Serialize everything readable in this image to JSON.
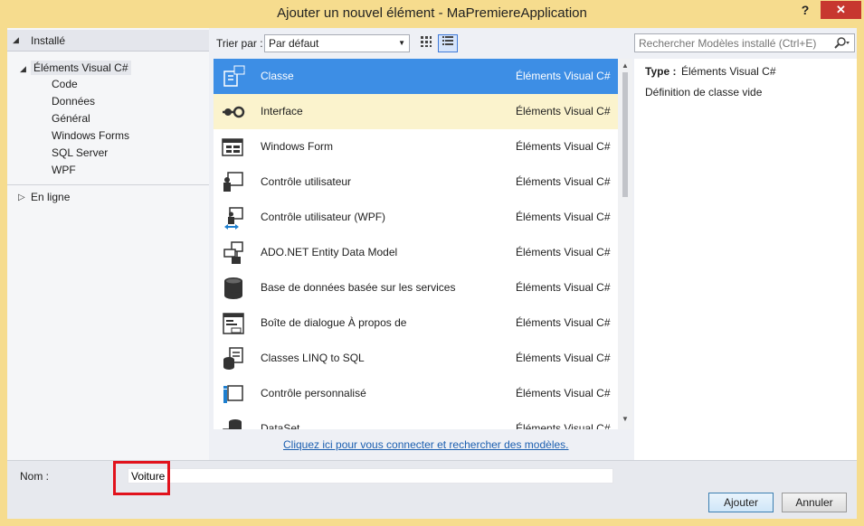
{
  "window": {
    "title": "Ajouter un nouvel élément - MaPremiereApplication",
    "help_label": "?",
    "close_label": "✕"
  },
  "tree": {
    "installed_label": "Installé",
    "root_label": "Éléments Visual C#",
    "children": [
      "Code",
      "Données",
      "Général",
      "Windows Forms",
      "SQL Server",
      "WPF"
    ],
    "online_label": "En ligne"
  },
  "toolbar": {
    "sort_label": "Trier par :",
    "sort_value": "Par défaut"
  },
  "items": [
    {
      "name": "Classe",
      "category": "Éléments Visual C#",
      "icon": "class-icon"
    },
    {
      "name": "Interface",
      "category": "Éléments Visual C#",
      "icon": "interface-icon"
    },
    {
      "name": "Windows Form",
      "category": "Éléments Visual C#",
      "icon": "windows-form-icon"
    },
    {
      "name": "Contrôle utilisateur",
      "category": "Éléments Visual C#",
      "icon": "user-control-icon"
    },
    {
      "name": "Contrôle utilisateur (WPF)",
      "category": "Éléments Visual C#",
      "icon": "wpf-user-control-icon"
    },
    {
      "name": "ADO.NET Entity Data Model",
      "category": "Éléments Visual C#",
      "icon": "entity-model-icon"
    },
    {
      "name": "Base de données basée sur les services",
      "category": "Éléments Visual C#",
      "icon": "database-icon"
    },
    {
      "name": "Boîte de dialogue À propos de",
      "category": "Éléments Visual C#",
      "icon": "about-box-icon"
    },
    {
      "name": "Classes LINQ to SQL",
      "category": "Éléments Visual C#",
      "icon": "linq-icon"
    },
    {
      "name": "Contrôle personnalisé",
      "category": "Éléments Visual C#",
      "icon": "custom-control-icon"
    },
    {
      "name": "DataSet",
      "category": "Éléments Visual C#",
      "icon": "dataset-icon"
    }
  ],
  "selected_index": 0,
  "hover_index": 1,
  "connect_link": "Cliquez ici pour vous connecter et rechercher des modèles.",
  "search": {
    "placeholder": "Rechercher Modèles installé (Ctrl+E)"
  },
  "details": {
    "type_label": "Type :",
    "type_value": "Éléments Visual C#",
    "description": "Définition de classe vide"
  },
  "form": {
    "name_label": "Nom :",
    "name_value": "Voiture",
    "ok_label": "Ajouter",
    "cancel_label": "Annuler"
  },
  "colors": {
    "title_bg": "#f6dc8e",
    "selection": "#3d8ee5",
    "hover": "#fbf3cd",
    "annotation": "#e1121c"
  }
}
